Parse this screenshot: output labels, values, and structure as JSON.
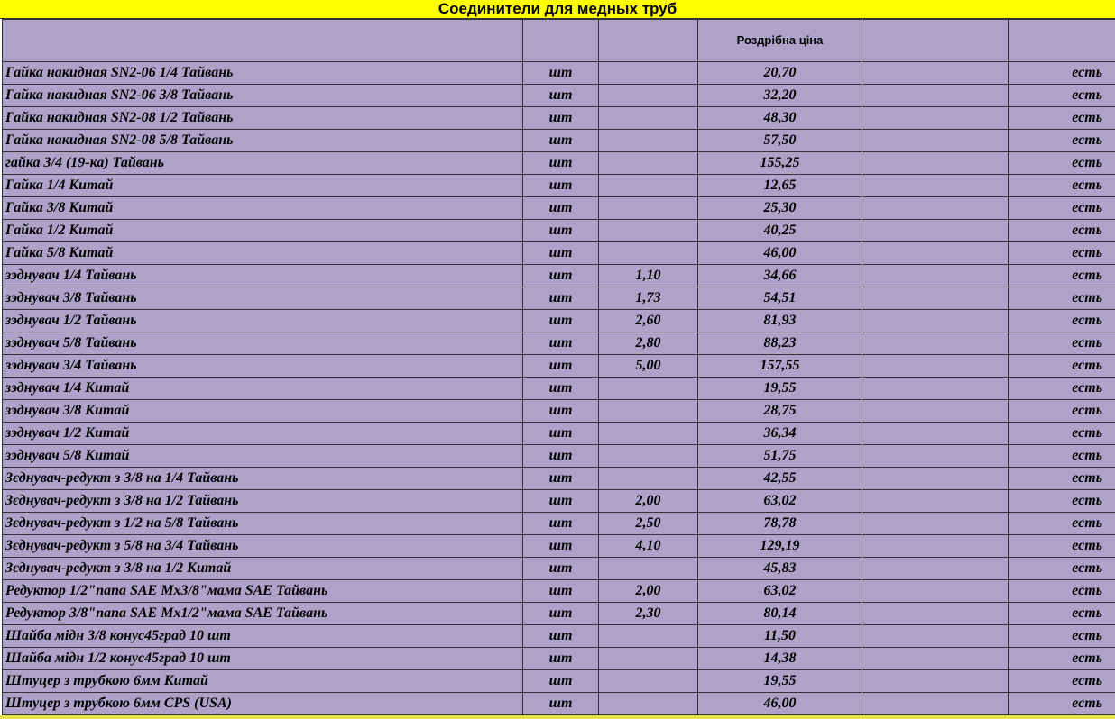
{
  "title": "Соединители для медных труб",
  "header": {
    "price_label": "Роздрібна ціна"
  },
  "colors": {
    "title_bg": "#ffff00",
    "table_bg": "#ada3c9"
  },
  "rows": [
    {
      "name": "Гайка накидная SN2-06 1/4 Тайвань",
      "unit": "шт",
      "num": "",
      "price": "20,70",
      "stock": "есть"
    },
    {
      "name": "Гайка накидная SN2-06 3/8 Тайвань",
      "unit": "шт",
      "num": "",
      "price": "32,20",
      "stock": "есть"
    },
    {
      "name": "Гайка накидная SN2-08 1/2 Тайвань",
      "unit": "шт",
      "num": "",
      "price": "48,30",
      "stock": "есть"
    },
    {
      "name": "Гайка накидная SN2-08 5/8 Тайвань",
      "unit": "шт",
      "num": "",
      "price": "57,50",
      "stock": "есть"
    },
    {
      "name": "гайка 3/4 (19-ка) Тайвань",
      "unit": "шт",
      "num": "",
      "price": "155,25",
      "stock": "есть"
    },
    {
      "name": "Гайка 1/4  Китай",
      "unit": "шт",
      "num": "",
      "price": "12,65",
      "stock": "есть"
    },
    {
      "name": "Гайка 3/8  Китай",
      "unit": "шт",
      "num": "",
      "price": "25,30",
      "stock": "есть"
    },
    {
      "name": "Гайка 1/2  Китай",
      "unit": "шт",
      "num": "",
      "price": "40,25",
      "stock": "есть"
    },
    {
      "name": "Гайка 5/8  Китай",
      "unit": "шт",
      "num": "",
      "price": "46,00",
      "stock": "есть"
    },
    {
      "name": "зэднувач 1/4 Тайвань",
      "unit": "шт",
      "num": "1,10",
      "price": "34,66",
      "stock": "есть"
    },
    {
      "name": "зэднувач 3/8 Тайвань",
      "unit": "шт",
      "num": "1,73",
      "price": "54,51",
      "stock": "есть"
    },
    {
      "name": "зэднувач 1/2 Тайвань",
      "unit": "шт",
      "num": "2,60",
      "price": "81,93",
      "stock": "есть"
    },
    {
      "name": "зэднувач 5/8 Тайвань",
      "unit": "шт",
      "num": "2,80",
      "price": "88,23",
      "stock": "есть"
    },
    {
      "name": "зэднувач 3/4 Тайвань",
      "unit": "шт",
      "num": "5,00",
      "price": "157,55",
      "stock": "есть"
    },
    {
      "name": "зэднувач 1/4 Китай",
      "unit": "шт",
      "num": "",
      "price": "19,55",
      "stock": "есть"
    },
    {
      "name": "зэднувач 3/8 Китай",
      "unit": "шт",
      "num": "",
      "price": "28,75",
      "stock": "есть"
    },
    {
      "name": "зэднувач 1/2 Китай",
      "unit": "шт",
      "num": "",
      "price": "36,34",
      "stock": "есть"
    },
    {
      "name": "зэднувач 5/8 Китай",
      "unit": "шт",
      "num": "",
      "price": "51,75",
      "stock": "есть"
    },
    {
      "name": "Зєднувач-редукт з 3/8 на 1/4 Тайвань",
      "unit": "шт",
      "num": "",
      "price": "42,55",
      "stock": "есть"
    },
    {
      "name": "Зєднувач-редукт з 3/8 на 1/2 Тайвань",
      "unit": "шт",
      "num": "2,00",
      "price": "63,02",
      "stock": "есть"
    },
    {
      "name": "Зєднувач-редукт з 1/2 на 5/8 Тайвань",
      "unit": "шт",
      "num": "2,50",
      "price": "78,78",
      "stock": "есть"
    },
    {
      "name": "Зєднувач-редукт з 5/8 на 3/4 Тайвань",
      "unit": "шт",
      "num": "4,10",
      "price": "129,19",
      "stock": "есть"
    },
    {
      "name": "Зєднувач-редукт з 3/8 на 1/2 Китай",
      "unit": "шт",
      "num": "",
      "price": "45,83",
      "stock": "есть"
    },
    {
      "name": "Редуктор 1/2\"папа SAE Мх3/8\"мама SAE Тайвань",
      "unit": "шт",
      "num": "2,00",
      "price": "63,02",
      "stock": "есть"
    },
    {
      "name": "Редуктор 3/8\"папа SAE Мх1/2\"мама SAE Тайвань",
      "unit": "шт",
      "num": "2,30",
      "price": "80,14",
      "stock": "есть"
    },
    {
      "name": "Шайба мідн 3/8 конус45град 10 шт",
      "unit": "шт",
      "num": "",
      "price": "11,50",
      "stock": "есть"
    },
    {
      "name": "Шайба мідн 1/2 конус45град 10 шт",
      "unit": "шт",
      "num": "",
      "price": "14,38",
      "stock": "есть"
    },
    {
      "name": "Штуцер з трубкою 6мм Китай",
      "unit": "шт",
      "num": "",
      "price": "19,55",
      "stock": "есть"
    },
    {
      "name": "Штуцер з трубкою 6мм CPS (USA)",
      "unit": "шт",
      "num": "",
      "price": "46,00",
      "stock": "есть"
    }
  ]
}
